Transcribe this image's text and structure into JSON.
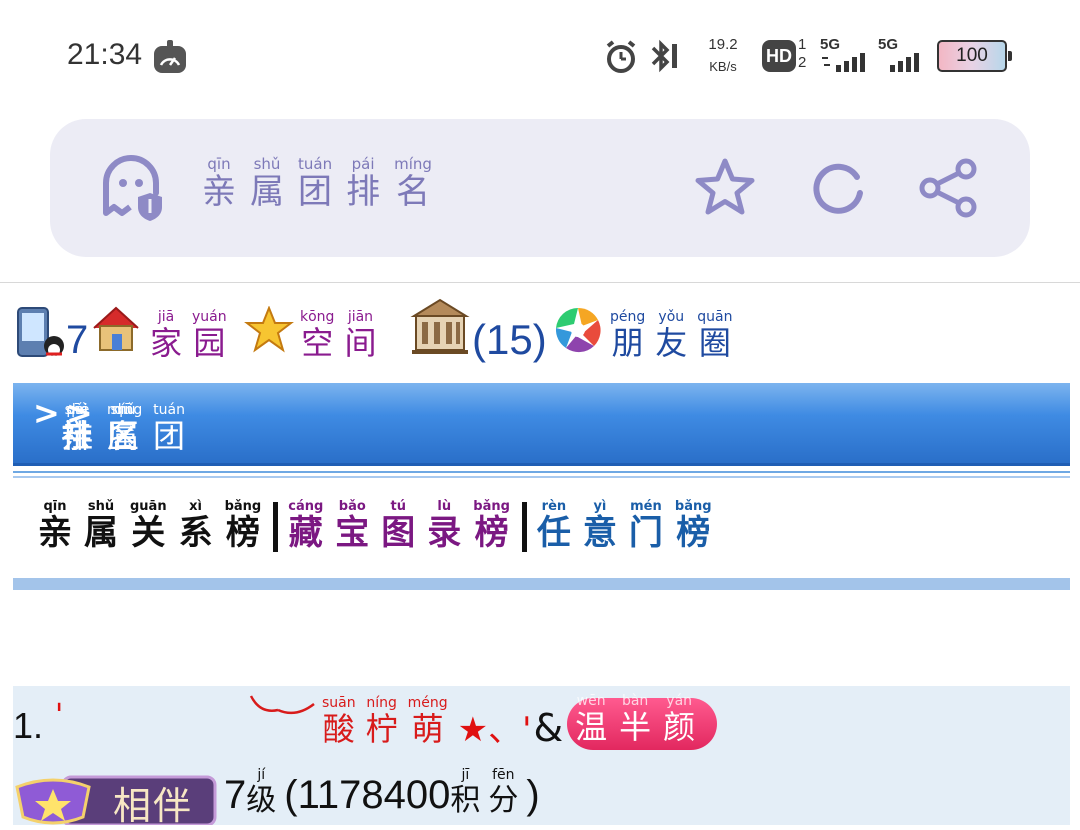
{
  "status_bar": {
    "time": "21:34",
    "net_speed": "19.2",
    "net_unit": "KB/s",
    "hd_label": "HD",
    "sim1": "1",
    "sim2": "2",
    "signal1_label": "5G",
    "signal2_label": "5G",
    "battery": "100"
  },
  "header": {
    "title": [
      {
        "char": "亲",
        "py": "qīn"
      },
      {
        "char": "属",
        "py": "shǔ"
      },
      {
        "char": "团",
        "py": "tuán"
      },
      {
        "char": "排",
        "py": "pái"
      },
      {
        "char": "名",
        "py": "míng"
      }
    ],
    "accent": "#7d79b8"
  },
  "nav_row": {
    "count_a": "7",
    "home": [
      {
        "char": "家",
        "py": "jiā"
      },
      {
        "char": "园",
        "py": "yuán"
      }
    ],
    "space": [
      {
        "char": "空",
        "py": "kōng"
      },
      {
        "char": "间",
        "py": "jiān"
      }
    ],
    "count_b": "(15)",
    "moments": [
      {
        "char": "朋",
        "py": "péng"
      },
      {
        "char": "友",
        "py": "yǒu"
      },
      {
        "char": "圈",
        "py": "quān"
      }
    ]
  },
  "breadcrumb": {
    "community": [
      {
        "char": "社",
        "py": "shè"
      },
      {
        "char": "区",
        "py": "qū"
      }
    ],
    "separator": ">",
    "group": [
      {
        "char": "亲",
        "py": "qīn"
      },
      {
        "char": "属",
        "py": "shǔ"
      },
      {
        "char": "团",
        "py": "tuán"
      }
    ],
    "rank": [
      {
        "char": "排",
        "py": "pái"
      },
      {
        "char": "名",
        "py": "míng"
      }
    ]
  },
  "tabs": {
    "relation": [
      {
        "char": "亲",
        "py": "qīn"
      },
      {
        "char": "属",
        "py": "shǔ"
      },
      {
        "char": "关",
        "py": "guān"
      },
      {
        "char": "系",
        "py": "xì"
      },
      {
        "char": "榜",
        "py": "bǎng"
      }
    ],
    "treasure": [
      {
        "char": "藏",
        "py": "cáng"
      },
      {
        "char": "宝",
        "py": "bǎo"
      },
      {
        "char": "图",
        "py": "tú"
      },
      {
        "char": "录",
        "py": "lù"
      },
      {
        "char": "榜",
        "py": "bǎng"
      }
    ],
    "quest": [
      {
        "char": "任",
        "py": "rèn"
      },
      {
        "char": "意",
        "py": "yì"
      },
      {
        "char": "门",
        "py": "mén"
      },
      {
        "char": "榜",
        "py": "bǎng"
      }
    ]
  },
  "entry": {
    "rank": "1.",
    "quote_open": "'",
    "nick": [
      {
        "char": "酸",
        "py": "suān"
      },
      {
        "char": "柠",
        "py": "níng"
      },
      {
        "char": "萌",
        "py": "méng"
      }
    ],
    "nick_suffix": "★、'",
    "amp": "&",
    "partner": [
      {
        "char": "温",
        "py": "wēn"
      },
      {
        "char": "半",
        "py": "bàn"
      },
      {
        "char": "颜",
        "py": "yán"
      }
    ],
    "badge_text": "相伴",
    "level_num": "7",
    "level_char": {
      "char": "级",
      "py": "jí"
    },
    "points": "(1178400",
    "points_label": [
      {
        "char": "积",
        "py": "jī"
      },
      {
        "char": "分",
        "py": "fēn"
      }
    ],
    "points_close": ")"
  }
}
